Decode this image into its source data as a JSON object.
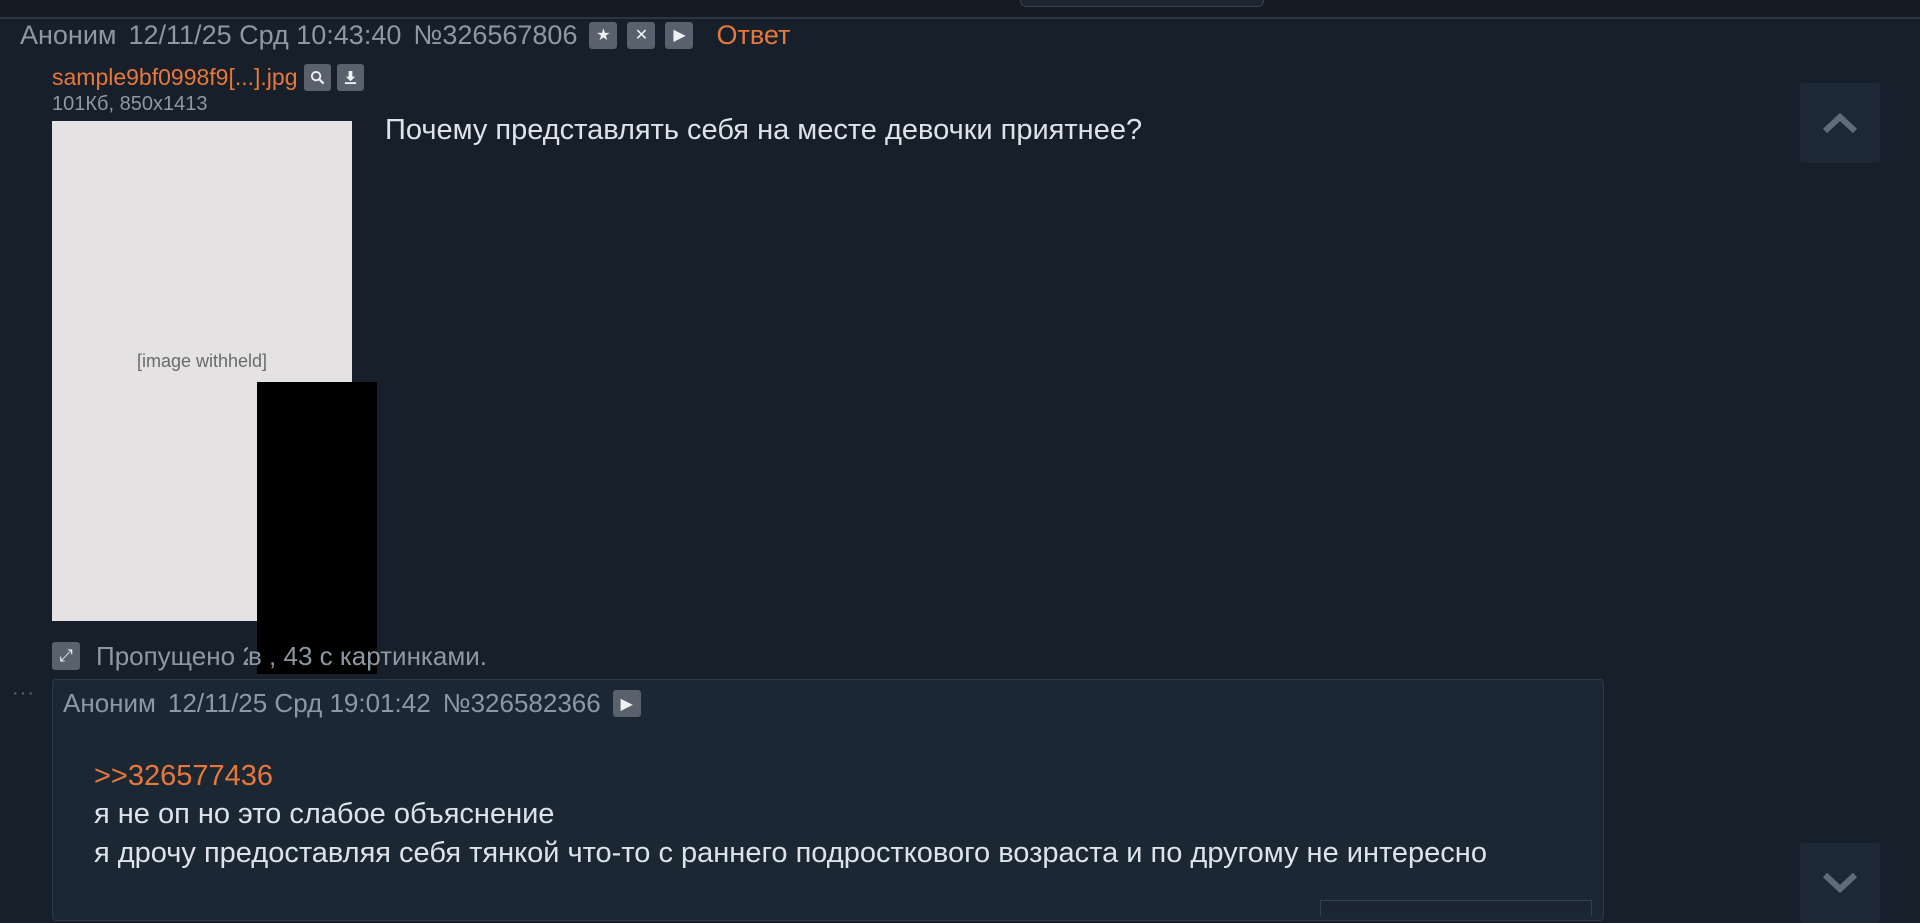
{
  "op": {
    "author": "Аноним",
    "date": "12/11/25 Срд 10:43:40",
    "post_number": "№326567806",
    "reply_label": "Ответ",
    "file": {
      "name": "sample9bf0998f9[...].jpg",
      "meta": "101Кб, 850x1413"
    },
    "text": "Почему представлять себя на месте девочки приятнее?"
  },
  "omitted": {
    "text": "Пропущено 2",
    "text_rest": "в , 43 с картинками."
  },
  "reply": {
    "author": "Аноним",
    "date": "12/11/25 Срд 19:01:42",
    "post_number": "№326582366",
    "quote": ">>326577436",
    "lines": [
      "я не оп но это слабое объяснение",
      "я дрочу предоставляя себя тянкой что-то с раннего подросткового возраста и по другому не интересно"
    ]
  },
  "colors": {
    "background": "#17202a",
    "accent_link": "#e8773a",
    "text": "#dde3e9",
    "muted": "#8d98a4",
    "button": "#59626c"
  },
  "icons": {
    "favorite": "star-icon",
    "hide": "close-icon",
    "play": "play-icon",
    "search_image": "search-icon",
    "download": "download-icon",
    "expand": "expand-icon",
    "scroll_up": "chevron-up-icon",
    "scroll_down": "chevron-down-icon"
  }
}
